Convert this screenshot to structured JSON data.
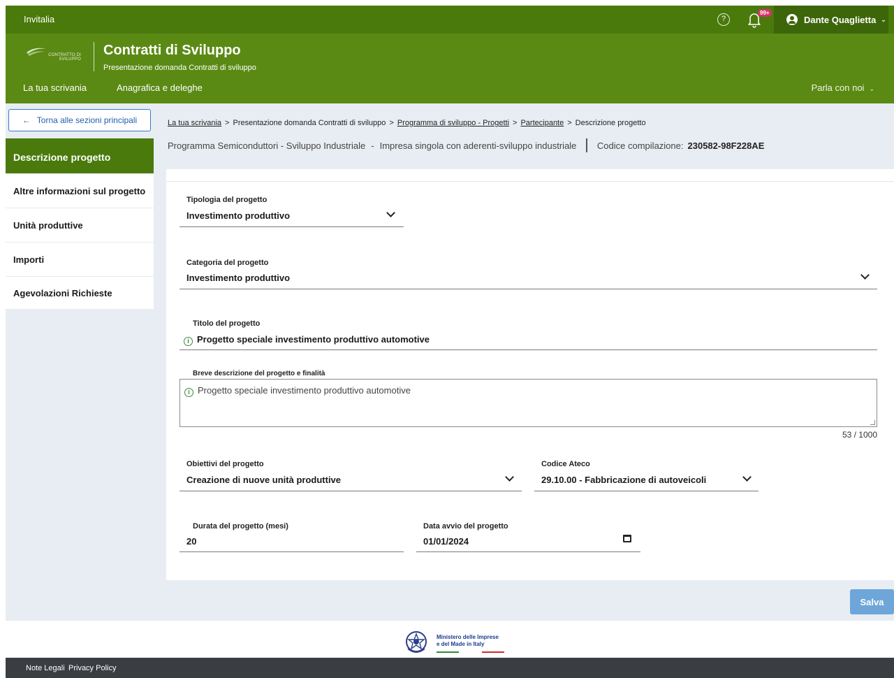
{
  "topbar": {
    "brand": "Invitalia",
    "help_icon": "question-circle-icon",
    "bell_icon": "bell-icon",
    "notifications_badge": "99+",
    "user_name": "Dante Quaglietta"
  },
  "header": {
    "logo_text": "CONTRATTO DI SVILUPPO",
    "title": "Contratti di Sviluppo",
    "subtitle": "Presentazione domanda Contratti di sviluppo",
    "nav": [
      "La tua scrivania",
      "Anagrafica e deleghe"
    ],
    "parla": "Parla con noi"
  },
  "back_button": "Torna alle sezioni principali",
  "sidebar": {
    "items": [
      {
        "label": "Descrizione progetto",
        "active": true
      },
      {
        "label": "Altre informazioni sul progetto",
        "active": false
      },
      {
        "label": "Unità produttive",
        "active": false
      },
      {
        "label": "Importi",
        "active": false
      },
      {
        "label": "Agevolazioni Richieste",
        "active": false
      }
    ]
  },
  "breadcrumb": {
    "items": [
      "La tua scrivania",
      "Presentazione domanda Contratti di sviluppo",
      "Programma di sviluppo - Progetti",
      "Partecipante",
      "Descrizione progetto"
    ],
    "separator": ">"
  },
  "info": {
    "programma": "Programma Semiconduttori - Sviluppo Industriale",
    "dash": "-",
    "tipo": "Impresa singola con aderenti-sviluppo industriale",
    "codice_label": "Codice compilazione:",
    "codice_value": "230582-98F228AE"
  },
  "form": {
    "tipologia": {
      "label": "Tipologia del progetto",
      "value": "Investimento produttivo"
    },
    "categoria": {
      "label": "Categoria del progetto",
      "value": "Investimento produttivo"
    },
    "titolo": {
      "label": "Titolo del progetto",
      "value": "Progetto speciale investimento produttivo automotive"
    },
    "descrizione": {
      "label": "Breve descrizione del progetto e finalità",
      "value": "Progetto speciale investimento produttivo automotive",
      "counter": "53 / 1000"
    },
    "obiettivi": {
      "label": "Obiettivi del progetto",
      "value": "Creazione di nuove unità produttive"
    },
    "ateco": {
      "label": "Codice Ateco",
      "value": "29.10.00 - Fabbricazione di autoveicoli"
    },
    "durata": {
      "label": "Durata del progetto (mesi)",
      "value": "20"
    },
    "data_avvio": {
      "label": "Data avvio del progetto",
      "value": "01/01/2024"
    }
  },
  "save_button": "Salva",
  "ministry": {
    "line1": "Ministero delle Imprese",
    "line2": "e del Made in Italy"
  },
  "footer": {
    "links": [
      "Note Legali",
      "Privacy Policy"
    ]
  },
  "colors": {
    "top_green": "#4a7a0c",
    "header_green": "#5a8a14",
    "accent_blue": "#3a78c9",
    "save_blue": "#6ea6d9",
    "content_bg": "#e8edf3"
  }
}
